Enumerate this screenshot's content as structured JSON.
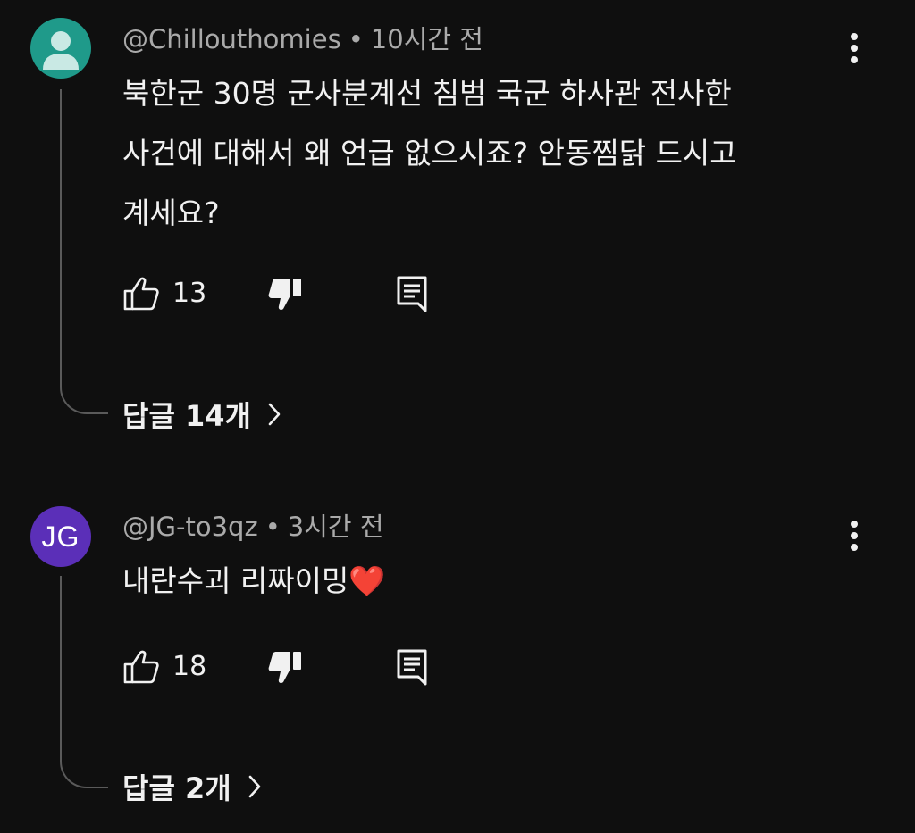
{
  "comments": [
    {
      "avatar": {
        "type": "default-person",
        "bg": "#1f9a8a",
        "fg": "#c9e9e4"
      },
      "author": "@Chillouthomies",
      "separator": "•",
      "time": "10시간 전",
      "text_lines": [
        "북한군 30명 군사분계선 침범 국군 하사관 전사한",
        "사건에 대해서 왜 언급 없으시죠? 안동찜닭 드시고",
        "계세요?"
      ],
      "likes": "13",
      "replies_label": "답글 14개",
      "icons": {
        "like": "thumbs-up-icon",
        "dislike": "thumbs-down-icon",
        "reply": "comment-icon",
        "more": "more-vertical-icon",
        "expand": "chevron-right-icon"
      }
    },
    {
      "avatar": {
        "type": "initials",
        "initials": "JG",
        "bg": "#5b2fb8",
        "fg": "#ffffff"
      },
      "author": "@JG-to3qz",
      "separator": "•",
      "time": "3시간 전",
      "text_lines": [
        "내란수괴 리짜이밍❤️"
      ],
      "likes": "18",
      "replies_label": "답글 2개",
      "icons": {
        "like": "thumbs-up-icon",
        "dislike": "thumbs-down-icon",
        "reply": "comment-icon",
        "more": "more-vertical-icon",
        "expand": "chevron-right-icon"
      }
    }
  ],
  "colors": {
    "background": "#0f0f0f",
    "text_primary": "#f1f1f1",
    "text_secondary": "#aaaaaa",
    "thread_line": "#5a5a5a"
  }
}
